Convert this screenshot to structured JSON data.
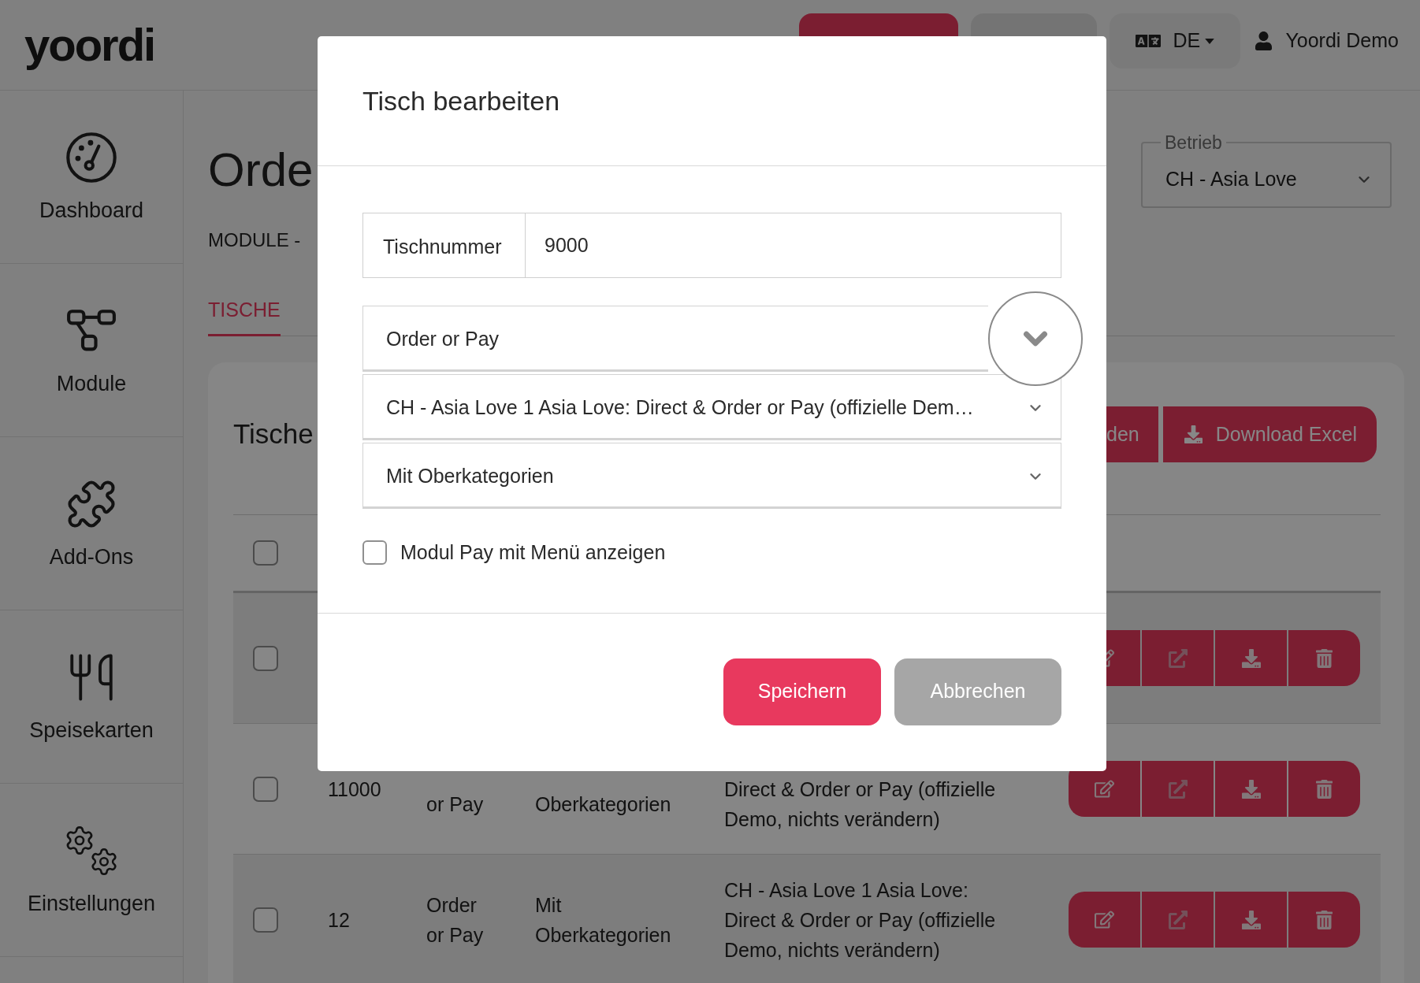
{
  "header": {
    "logo": "yoordi",
    "action_buttons": [
      {
        "kind": "primary"
      },
      {
        "kind": "secondary"
      }
    ],
    "language": {
      "label": "DE"
    },
    "user": {
      "name": "Yoordi Demo"
    }
  },
  "sidebar": {
    "items": [
      {
        "label": "Dashboard",
        "selected": false
      },
      {
        "label": "Module",
        "selected": false
      },
      {
        "label": "Add-Ons",
        "selected": false
      },
      {
        "label": "Speisekarten",
        "selected": false
      },
      {
        "label": "Einstellungen",
        "selected": false
      }
    ]
  },
  "page": {
    "title": "Orde",
    "breadcrumb": "MODULE -",
    "business_select": {
      "legend": "Betrieb",
      "value": "CH - Asia Love"
    },
    "tabs": [
      {
        "label": "TISCHE",
        "selected": true
      }
    ]
  },
  "card": {
    "title": "Tische",
    "buttons": [
      {
        "label": "den",
        "kind": "plain"
      },
      {
        "label": "Download Excel",
        "kind": "download"
      }
    ],
    "table": {
      "header_checkbox": {
        "checked": false
      },
      "rows": [
        {
          "checked": false
        },
        {
          "checked": false,
          "cells": [
            "11000",
            "or Pay",
            "Oberkategorien",
            "Direct & Order or Pay (offizielle Demo, nichts verändern)"
          ]
        },
        {
          "checked": false,
          "cells": [
            "12",
            "Order or Pay",
            "Mit Oberkategorien",
            "CH - Asia Love 1 Asia Love: Direct & Order or Pay (offizielle Demo, nichts verändern)"
          ]
        }
      ]
    }
  },
  "dialog": {
    "title": "Tisch bearbeiten",
    "table_number": {
      "label": "Tischnummer",
      "value": "9000"
    },
    "selects": [
      {
        "value": "Order or Pay",
        "highlighted": true
      },
      {
        "value": "CH - Asia Love 1 Asia Love: Direct & Order or Pay (offizielle Dem…",
        "highlighted": false
      },
      {
        "value": "Mit Oberkategorien",
        "highlighted": false
      }
    ],
    "checkbox": {
      "label": "Modul Pay mit Menü anzeigen",
      "checked": false
    },
    "buttons": [
      {
        "label": "Speichern",
        "kind": "primary"
      },
      {
        "label": "Abbrechen",
        "kind": "secondary"
      }
    ]
  }
}
